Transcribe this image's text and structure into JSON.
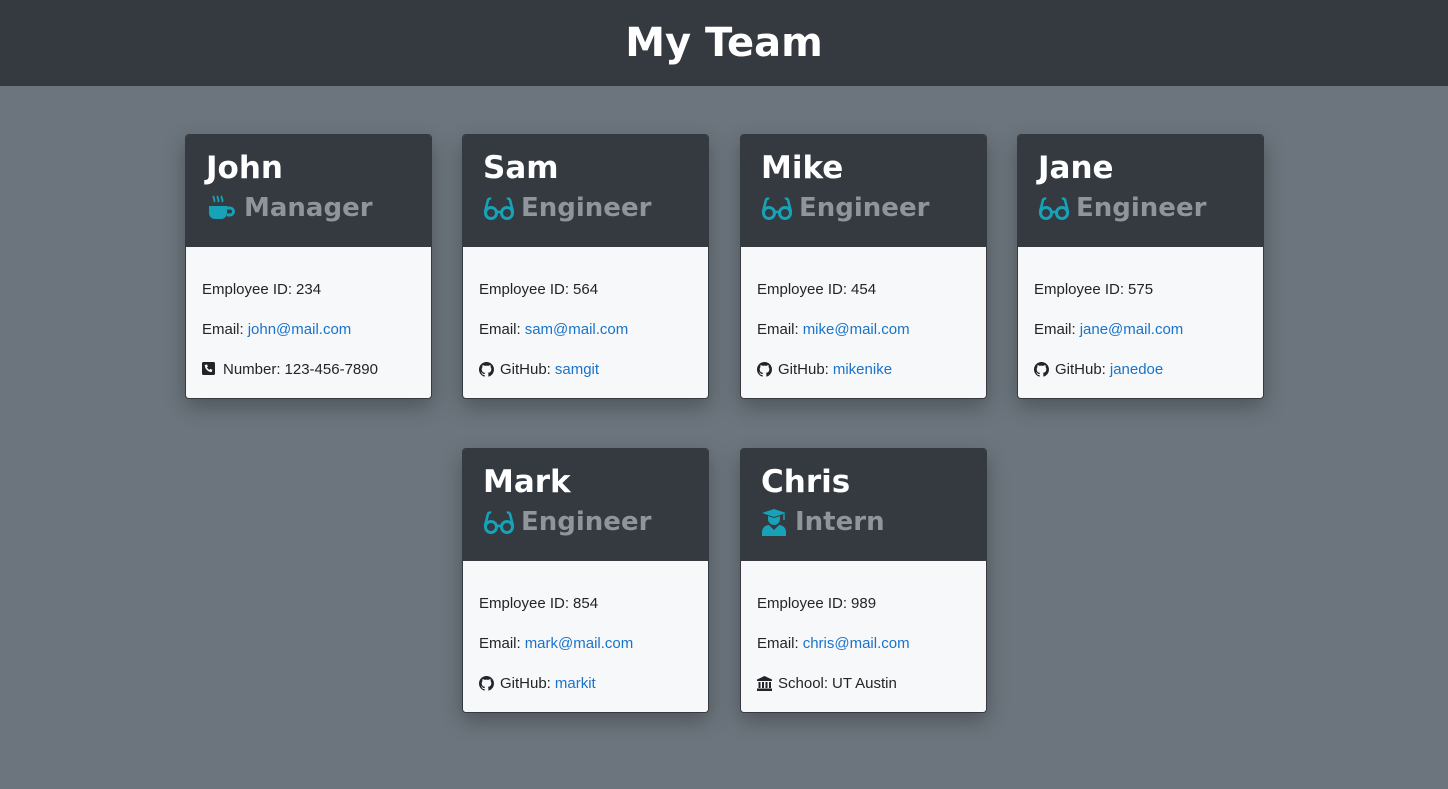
{
  "page": {
    "title": "My Team"
  },
  "colors": {
    "accent": "#17a2b8",
    "link": "#1a73c9",
    "header_bg": "#343a40",
    "page_bg": "#6c757d",
    "card_body_bg": "#f7f8fa"
  },
  "employees": [
    {
      "name": "John",
      "role": "Manager",
      "role_icon": "coffee-icon",
      "id_label": "Employee ID:",
      "id": "234",
      "email_label": "Email:",
      "email": "john@mail.com",
      "extra_icon": "phone-icon",
      "extra_label": "Number:",
      "extra_value": "123-456-7890"
    },
    {
      "name": "Sam",
      "role": "Engineer",
      "role_icon": "glasses-icon",
      "id_label": "Employee ID:",
      "id": "564",
      "email_label": "Email:",
      "email": "sam@mail.com",
      "extra_icon": "github-icon",
      "extra_label": "GitHub:",
      "extra_value": "samgit"
    },
    {
      "name": "Mike",
      "role": "Engineer",
      "role_icon": "glasses-icon",
      "id_label": "Employee ID:",
      "id": "454",
      "email_label": "Email:",
      "email": "mike@mail.com",
      "extra_icon": "github-icon",
      "extra_label": "GitHub:",
      "extra_value": "mikenike"
    },
    {
      "name": "Jane",
      "role": "Engineer",
      "role_icon": "glasses-icon",
      "id_label": "Employee ID:",
      "id": "575",
      "email_label": "Email:",
      "email": "jane@mail.com",
      "extra_icon": "github-icon",
      "extra_label": "GitHub:",
      "extra_value": "janedoe"
    },
    {
      "name": "Mark",
      "role": "Engineer",
      "role_icon": "glasses-icon",
      "id_label": "Employee ID:",
      "id": "854",
      "email_label": "Email:",
      "email": "mark@mail.com",
      "extra_icon": "github-icon",
      "extra_label": "GitHub:",
      "extra_value": "markit"
    },
    {
      "name": "Chris",
      "role": "Intern",
      "role_icon": "graduate-icon",
      "id_label": "Employee ID:",
      "id": "989",
      "email_label": "Email:",
      "email": "chris@mail.com",
      "extra_icon": "school-icon",
      "extra_label": "School:",
      "extra_value": "UT Austin"
    }
  ]
}
